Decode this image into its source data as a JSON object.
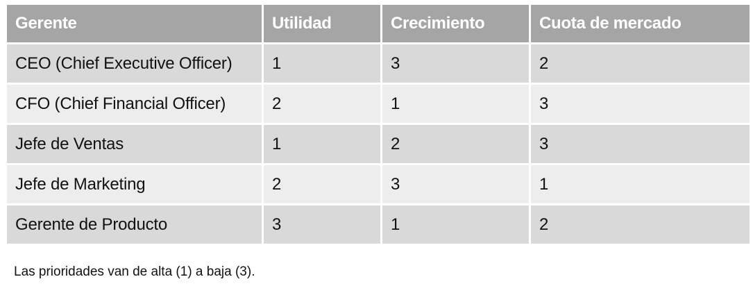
{
  "table": {
    "headers": [
      "Gerente",
      "Utilidad",
      "Crecimiento",
      "Cuota de mercado"
    ],
    "rows": [
      [
        "CEO (Chief Executive Officer)",
        "1",
        "3",
        "2"
      ],
      [
        "CFO (Chief Financial Officer)",
        "2",
        "1",
        "3"
      ],
      [
        "Jefe de Ventas",
        "1",
        "2",
        "3"
      ],
      [
        "Jefe de Marketing",
        "2",
        "3",
        "1"
      ],
      [
        "Gerente de Producto",
        "3",
        "1",
        "2"
      ]
    ]
  },
  "footnote": "Las prioridades van de alta (1) a baja (3).",
  "colors": {
    "header_bg": "#a5a5a5",
    "header_text": "#ffffff",
    "row_odd_bg": "#d9d9d9",
    "row_even_bg": "#ededed"
  }
}
